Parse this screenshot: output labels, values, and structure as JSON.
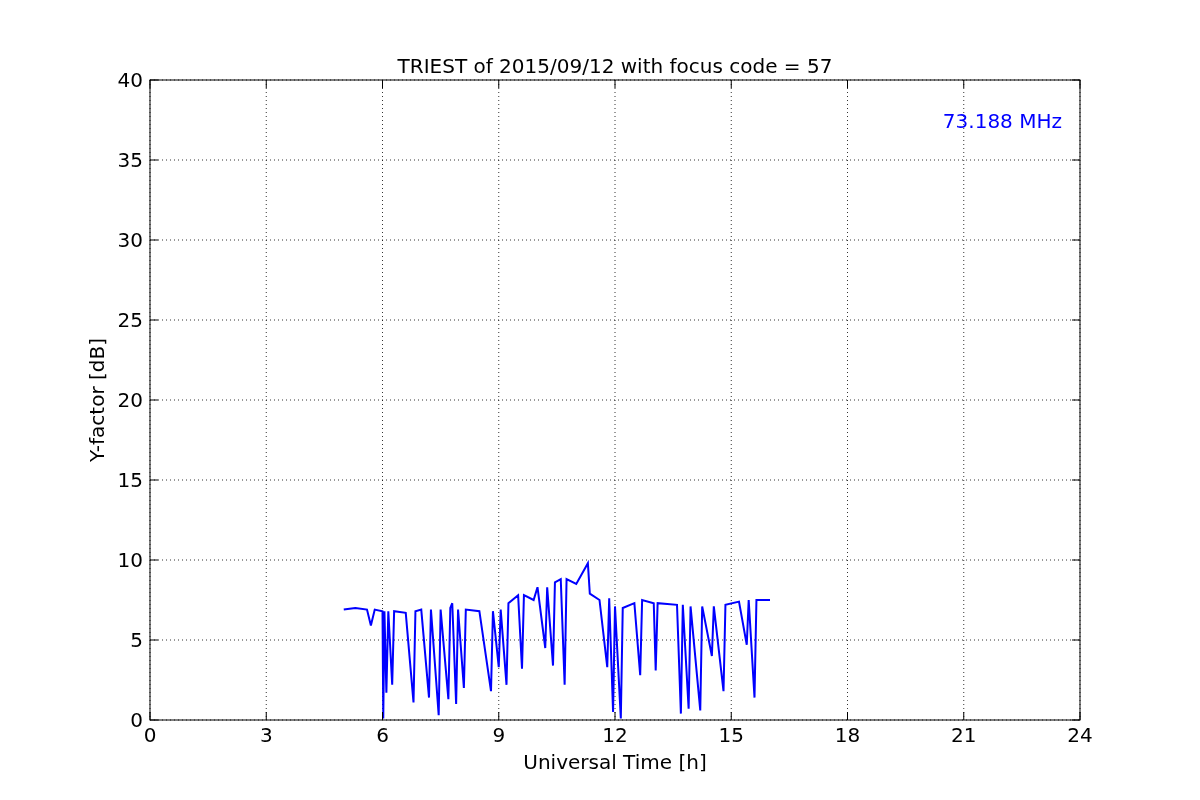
{
  "chart_data": {
    "type": "line",
    "title": "TRIEST of 2015/09/12 with focus code = 57",
    "xlabel": "Universal Time [h]",
    "ylabel": "Y-factor [dB]",
    "x": [
      5.0,
      5.3,
      5.6,
      5.7,
      5.8,
      6.0,
      6.02,
      6.05,
      6.1,
      6.15,
      6.25,
      6.3,
      6.6,
      6.8,
      6.85,
      7.0,
      7.2,
      7.25,
      7.45,
      7.5,
      7.7,
      7.75,
      7.8,
      7.9,
      7.95,
      8.1,
      8.15,
      8.5,
      8.8,
      8.85,
      9.0,
      9.05,
      9.2,
      9.25,
      9.5,
      9.6,
      9.65,
      9.9,
      10.0,
      10.2,
      10.25,
      10.4,
      10.45,
      10.6,
      10.7,
      10.75,
      11.0,
      11.3,
      11.35,
      11.6,
      11.8,
      11.85,
      11.95,
      12.0,
      12.15,
      12.2,
      12.5,
      12.65,
      12.7,
      13.0,
      13.05,
      13.1,
      13.6,
      13.7,
      13.75,
      13.9,
      13.95,
      14.2,
      14.25,
      14.5,
      14.55,
      14.8,
      14.85,
      15.2,
      15.4,
      15.45,
      15.6,
      15.65,
      16.0
    ],
    "series": [
      {
        "name": "73.188 MHz",
        "color": "#0000ff",
        "values": [
          6.9,
          7.0,
          6.9,
          5.9,
          6.9,
          6.8,
          0.1,
          6.8,
          1.7,
          6.8,
          2.2,
          6.8,
          6.7,
          1.1,
          6.8,
          6.9,
          1.4,
          6.9,
          0.3,
          6.9,
          1.3,
          7.0,
          7.3,
          1.0,
          6.9,
          2.0,
          6.9,
          6.8,
          1.8,
          6.8,
          3.3,
          6.9,
          2.2,
          7.3,
          7.8,
          3.2,
          7.8,
          7.5,
          8.3,
          4.5,
          8.3,
          3.4,
          8.6,
          8.8,
          2.2,
          8.8,
          8.5,
          9.8,
          7.9,
          7.5,
          3.3,
          7.6,
          0.5,
          7.1,
          0.1,
          7.0,
          7.3,
          2.8,
          7.5,
          7.3,
          3.1,
          7.3,
          7.2,
          0.4,
          7.2,
          0.7,
          7.1,
          0.6,
          7.1,
          4.0,
          7.1,
          1.8,
          7.2,
          7.4,
          4.7,
          7.5,
          1.4,
          7.5,
          7.5
        ]
      }
    ],
    "xlim": [
      0,
      24
    ],
    "ylim": [
      0,
      40
    ],
    "xticks": [
      0,
      3,
      6,
      9,
      12,
      15,
      18,
      21,
      24
    ],
    "yticks": [
      0,
      5,
      10,
      15,
      20,
      25,
      30,
      35,
      40
    ],
    "grid": true
  }
}
